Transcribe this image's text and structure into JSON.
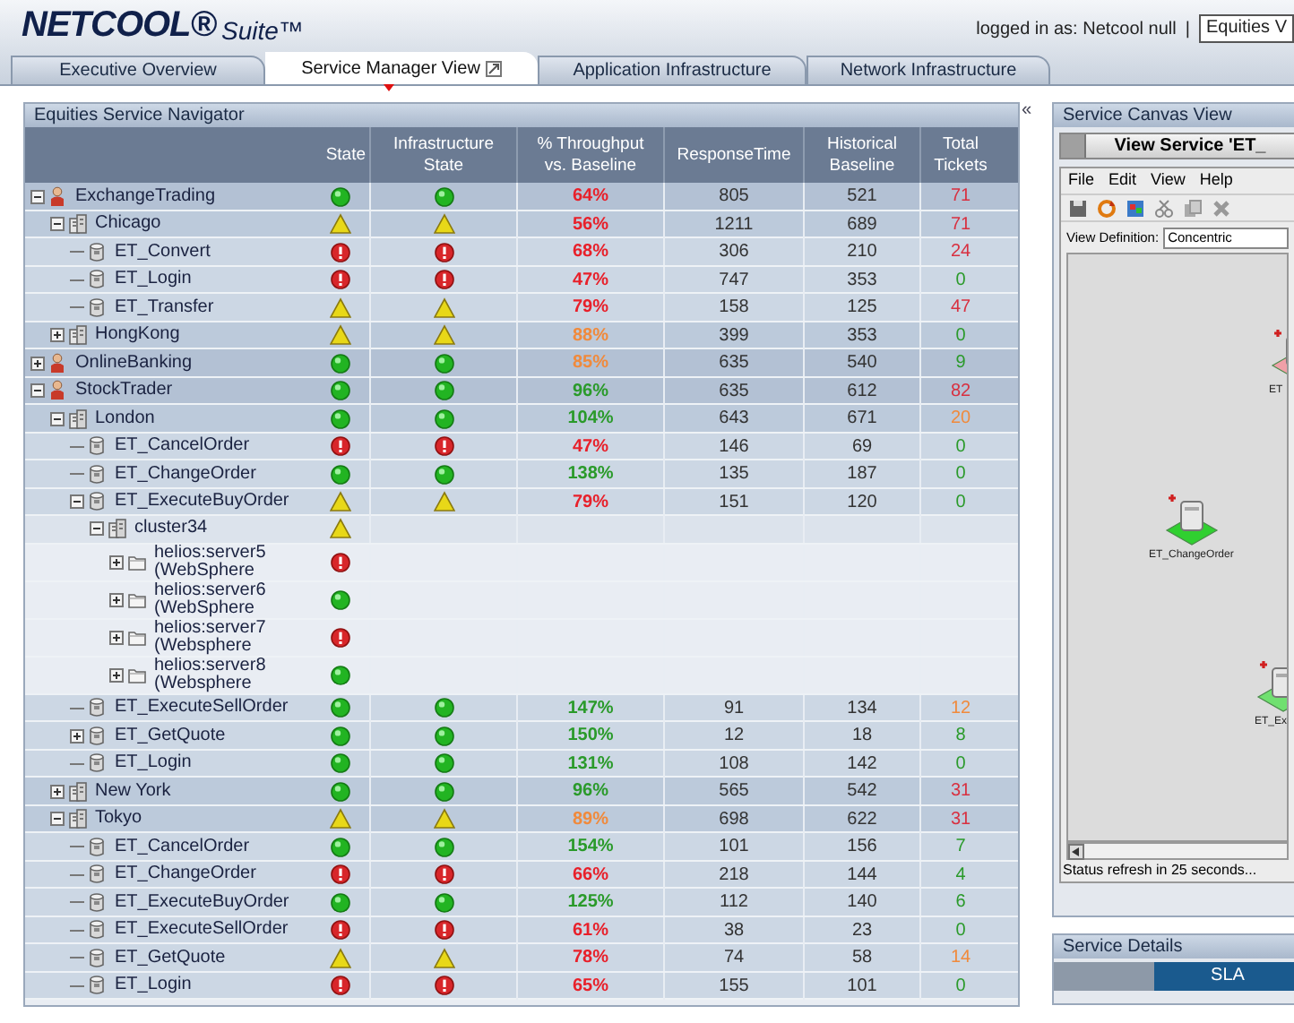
{
  "header": {
    "logo": "NETCOOL®",
    "logo_suffix": "Suite™",
    "user": "logged in as: Netcool null",
    "separator": "|",
    "view_select": "Equities V"
  },
  "tabs": [
    {
      "label": "Executive Overview",
      "selected": false
    },
    {
      "label": "Service Manager View",
      "selected": true
    },
    {
      "label": "Application Infrastructure",
      "selected": false
    },
    {
      "label": "Network Infrastructure",
      "selected": false
    }
  ],
  "navigator": {
    "title": "Equities Service Navigator",
    "collapse": "«",
    "columns": [
      "State",
      "Infrastructure\nState",
      "% Throughput\nvs. Baseline",
      "ResponseTime",
      "Historical\nBaseline",
      "Total\nTickets"
    ],
    "rows": [
      {
        "name": "ExchangeTrading",
        "kind": "service",
        "state": {
          "kind": "ok"
        },
        "infra_state": {
          "kind": "ok"
        },
        "throughput": {
          "text": "64%",
          "color": "#e8202a"
        },
        "response": "805",
        "baseline": "521",
        "tickets": {
          "text": "71",
          "color": "#d83040"
        },
        "expanded": true,
        "children": [
          {
            "name": "Chicago",
            "kind": "site",
            "state": {
              "kind": "warning"
            },
            "infra_state": {
              "kind": "warning"
            },
            "throughput": {
              "text": "56%",
              "color": "#e8202a"
            },
            "response": "1211",
            "baseline": "689",
            "tickets": {
              "text": "71",
              "color": "#d83040"
            },
            "expanded": true,
            "children": [
              {
                "name": "ET_Convert",
                "kind": "transaction",
                "state": {
                  "kind": "critical"
                },
                "infra_state": {
                  "kind": "critical"
                },
                "throughput": {
                  "text": "68%",
                  "color": "#e8202a"
                },
                "response": "306",
                "baseline": "210",
                "tickets": {
                  "text": "24",
                  "color": "#d83040"
                }
              },
              {
                "name": "ET_Login",
                "kind": "transaction",
                "state": {
                  "kind": "critical"
                },
                "infra_state": {
                  "kind": "critical"
                },
                "throughput": {
                  "text": "47%",
                  "color": "#e8202a"
                },
                "response": "747",
                "baseline": "353",
                "tickets": {
                  "text": "0",
                  "color": "#2a9a2a"
                }
              },
              {
                "name": "ET_Transfer",
                "kind": "transaction",
                "state": {
                  "kind": "warning"
                },
                "infra_state": {
                  "kind": "warning"
                },
                "throughput": {
                  "text": "79%",
                  "color": "#e8202a"
                },
                "response": "158",
                "baseline": "125",
                "tickets": {
                  "text": "47",
                  "color": "#d83040"
                }
              }
            ]
          },
          {
            "name": "HongKong",
            "kind": "site",
            "state": {
              "kind": "warning"
            },
            "infra_state": {
              "kind": "warning"
            },
            "throughput": {
              "text": "88%",
              "color": "#f08a3c"
            },
            "response": "399",
            "baseline": "353",
            "tickets": {
              "text": "0",
              "color": "#2a9a2a"
            },
            "expanded": false
          }
        ]
      },
      {
        "name": "OnlineBanking",
        "kind": "service",
        "state": {
          "kind": "ok"
        },
        "infra_state": {
          "kind": "ok"
        },
        "throughput": {
          "text": "85%",
          "color": "#f08a3c"
        },
        "response": "635",
        "baseline": "540",
        "tickets": {
          "text": "9",
          "color": "#2a9a2a"
        },
        "expanded": false
      },
      {
        "name": "StockTrader",
        "kind": "service",
        "state": {
          "kind": "ok"
        },
        "infra_state": {
          "kind": "ok"
        },
        "throughput": {
          "text": "96%",
          "color": "#2a9a2a"
        },
        "response": "635",
        "baseline": "612",
        "tickets": {
          "text": "82",
          "color": "#d83040"
        },
        "expanded": true,
        "children": [
          {
            "name": "London",
            "kind": "site",
            "state": {
              "kind": "ok"
            },
            "infra_state": {
              "kind": "ok"
            },
            "throughput": {
              "text": "104%",
              "color": "#2a9a2a"
            },
            "response": "643",
            "baseline": "671",
            "tickets": {
              "text": "20",
              "color": "#f08a3c"
            },
            "expanded": true,
            "children": [
              {
                "name": "ET_CancelOrder",
                "kind": "transaction",
                "state": {
                  "kind": "critical"
                },
                "infra_state": {
                  "kind": "critical"
                },
                "throughput": {
                  "text": "47%",
                  "color": "#e8202a"
                },
                "response": "146",
                "baseline": "69",
                "tickets": {
                  "text": "0",
                  "color": "#2a9a2a"
                }
              },
              {
                "name": "ET_ChangeOrder",
                "kind": "transaction",
                "state": {
                  "kind": "ok"
                },
                "infra_state": {
                  "kind": "ok"
                },
                "throughput": {
                  "text": "138%",
                  "color": "#2a9a2a"
                },
                "response": "135",
                "baseline": "187",
                "tickets": {
                  "text": "0",
                  "color": "#2a9a2a"
                }
              },
              {
                "name": "ET_ExecuteBuyOrder",
                "kind": "transaction",
                "state": {
                  "kind": "warning"
                },
                "infra_state": {
                  "kind": "warning"
                },
                "throughput": {
                  "text": "79%",
                  "color": "#e8202a"
                },
                "response": "151",
                "baseline": "120",
                "tickets": {
                  "text": "0",
                  "color": "#2a9a2a"
                },
                "expanded": true,
                "children": [
                  {
                    "name": "cluster34",
                    "kind": "cluster",
                    "state": {
                      "kind": "warning"
                    },
                    "expanded": true,
                    "children": [
                      {
                        "name": "helios:server5 (WebSphere",
                        "kind": "server",
                        "state": {
                          "kind": "critical"
                        },
                        "expanded": false
                      },
                      {
                        "name": "helios:server6 (WebSphere",
                        "kind": "server",
                        "state": {
                          "kind": "ok"
                        },
                        "expanded": false
                      },
                      {
                        "name": "helios:server7 (Websphere",
                        "kind": "server",
                        "state": {
                          "kind": "critical"
                        },
                        "expanded": false
                      },
                      {
                        "name": "helios:server8 (Websphere",
                        "kind": "server",
                        "state": {
                          "kind": "ok"
                        },
                        "expanded": false
                      }
                    ]
                  }
                ]
              },
              {
                "name": "ET_ExecuteSellOrder",
                "kind": "transaction",
                "state": {
                  "kind": "ok"
                },
                "infra_state": {
                  "kind": "ok"
                },
                "throughput": {
                  "text": "147%",
                  "color": "#2a9a2a"
                },
                "response": "91",
                "baseline": "134",
                "tickets": {
                  "text": "12",
                  "color": "#f08a3c"
                }
              },
              {
                "name": "ET_GetQuote",
                "kind": "transaction",
                "state": {
                  "kind": "ok"
                },
                "infra_state": {
                  "kind": "ok"
                },
                "throughput": {
                  "text": "150%",
                  "color": "#2a9a2a"
                },
                "response": "12",
                "baseline": "18",
                "tickets": {
                  "text": "8",
                  "color": "#2a9a2a"
                },
                "expanded": false
              },
              {
                "name": "ET_Login",
                "kind": "transaction",
                "state": {
                  "kind": "ok"
                },
                "infra_state": {
                  "kind": "ok"
                },
                "throughput": {
                  "text": "131%",
                  "color": "#2a9a2a"
                },
                "response": "108",
                "baseline": "142",
                "tickets": {
                  "text": "0",
                  "color": "#2a9a2a"
                }
              }
            ]
          },
          {
            "name": "New York",
            "kind": "site",
            "state": {
              "kind": "ok"
            },
            "infra_state": {
              "kind": "ok"
            },
            "throughput": {
              "text": "96%",
              "color": "#2a9a2a"
            },
            "response": "565",
            "baseline": "542",
            "tickets": {
              "text": "31",
              "color": "#d83040"
            },
            "expanded": false
          },
          {
            "name": "Tokyo",
            "kind": "site",
            "state": {
              "kind": "warning"
            },
            "infra_state": {
              "kind": "warning"
            },
            "throughput": {
              "text": "89%",
              "color": "#f08a3c"
            },
            "response": "698",
            "baseline": "622",
            "tickets": {
              "text": "31",
              "color": "#d83040"
            },
            "expanded": true,
            "children": [
              {
                "name": "ET_CancelOrder",
                "kind": "transaction",
                "state": {
                  "kind": "ok"
                },
                "infra_state": {
                  "kind": "ok"
                },
                "throughput": {
                  "text": "154%",
                  "color": "#2a9a2a"
                },
                "response": "101",
                "baseline": "156",
                "tickets": {
                  "text": "7",
                  "color": "#2a9a2a"
                }
              },
              {
                "name": "ET_ChangeOrder",
                "kind": "transaction",
                "state": {
                  "kind": "critical"
                },
                "infra_state": {
                  "kind": "critical"
                },
                "throughput": {
                  "text": "66%",
                  "color": "#e8202a"
                },
                "response": "218",
                "baseline": "144",
                "tickets": {
                  "text": "4",
                  "color": "#2a9a2a"
                }
              },
              {
                "name": "ET_ExecuteBuyOrder",
                "kind": "transaction",
                "state": {
                  "kind": "ok"
                },
                "infra_state": {
                  "kind": "ok"
                },
                "throughput": {
                  "text": "125%",
                  "color": "#2a9a2a"
                },
                "response": "112",
                "baseline": "140",
                "tickets": {
                  "text": "6",
                  "color": "#2a9a2a"
                }
              },
              {
                "name": "ET_ExecuteSellOrder",
                "kind": "transaction",
                "state": {
                  "kind": "critical"
                },
                "infra_state": {
                  "kind": "critical"
                },
                "throughput": {
                  "text": "61%",
                  "color": "#e8202a"
                },
                "response": "38",
                "baseline": "23",
                "tickets": {
                  "text": "0",
                  "color": "#2a9a2a"
                }
              },
              {
                "name": "ET_GetQuote",
                "kind": "transaction",
                "state": {
                  "kind": "warning"
                },
                "infra_state": {
                  "kind": "warning"
                },
                "throughput": {
                  "text": "78%",
                  "color": "#e8202a"
                },
                "response": "74",
                "baseline": "58",
                "tickets": {
                  "text": "14",
                  "color": "#f08a3c"
                }
              },
              {
                "name": "ET_Login",
                "kind": "transaction",
                "state": {
                  "kind": "critical"
                },
                "infra_state": {
                  "kind": "critical"
                },
                "throughput": {
                  "text": "65%",
                  "color": "#e8202a"
                },
                "response": "155",
                "baseline": "101",
                "tickets": {
                  "text": "0",
                  "color": "#2a9a2a"
                }
              }
            ]
          }
        ]
      }
    ]
  },
  "canvas": {
    "title": "Service Canvas View",
    "window_title": "View Service 'ET_",
    "menu": [
      "File",
      "Edit",
      "View",
      "Help"
    ],
    "view_definition": {
      "label": "View Definition:",
      "value": "Concentric"
    },
    "nodes": [
      {
        "label": "ET",
        "color": "#f0a0a8"
      },
      {
        "label": "ET_ChangeOrder",
        "color": "#30d030"
      },
      {
        "label": "ET_Ex",
        "color": "#70e070"
      }
    ],
    "status": "Status refresh in 25 seconds..."
  },
  "details": {
    "title": "Service Details",
    "tabs": [
      {
        "label": "SLA",
        "selected": true
      }
    ]
  }
}
